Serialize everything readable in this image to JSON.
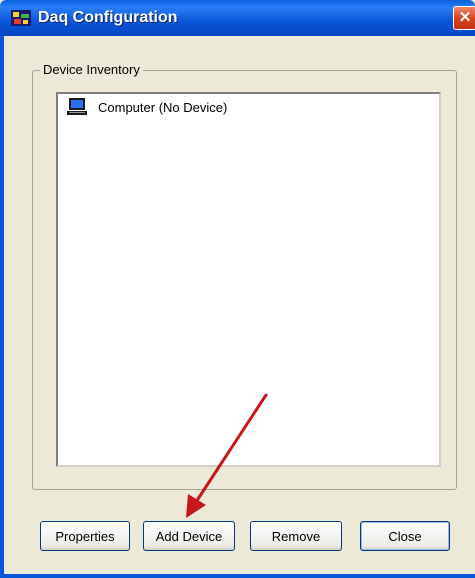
{
  "window": {
    "title": "Daq Configuration",
    "close_glyph": "✕",
    "app_icon": "daq-app-icon"
  },
  "inventory": {
    "group_label": "Device Inventory",
    "items": [
      {
        "icon": "computer-icon",
        "label": "Computer (No Device)"
      }
    ]
  },
  "buttons": {
    "properties": "Properties",
    "add_device": "Add Device",
    "remove": "Remove",
    "close": "Close"
  },
  "annotation": {
    "arrow_color": "#c8161d",
    "points_to": "add-device-button"
  }
}
